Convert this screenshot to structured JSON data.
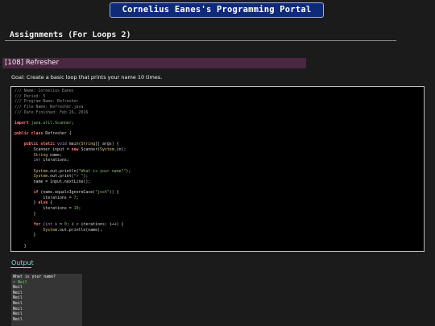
{
  "banner": {
    "title": "Cornelius Eanes's Programming Portal"
  },
  "page": {
    "title": "Assignments (For Loops 2)"
  },
  "assignment": {
    "header": "[108] Refresher",
    "goal": "Goal: Create a basic loop that prints your name 10 times."
  },
  "code": {
    "lines": [
      [
        [
          "c-comment",
          "/// Name: Cornelius Eanes"
        ]
      ],
      [
        [
          "c-comment",
          "/// Period: 5"
        ]
      ],
      [
        [
          "c-comment",
          "/// Program Name: Refresher"
        ]
      ],
      [
        [
          "c-comment",
          "/// File Name: Refresher.java"
        ]
      ],
      [
        [
          "c-comment",
          "/// Date Finished: Feb 26, 2016"
        ]
      ],
      [],
      [
        [
          "c-kw",
          "import"
        ],
        [
          "c-plain",
          " "
        ],
        [
          "c-str",
          "java.util.Scanner"
        ],
        [
          "c-plain",
          ";"
        ]
      ],
      [],
      [
        [
          "c-kw",
          "public class"
        ],
        [
          "c-plain",
          " Refresher {"
        ]
      ],
      [],
      [
        [
          "c-plain",
          "    "
        ],
        [
          "c-kw",
          "public static"
        ],
        [
          "c-plain",
          " "
        ],
        [
          "c-type",
          "void"
        ],
        [
          "c-plain",
          " main("
        ],
        [
          "c-cls",
          "String"
        ],
        [
          "c-plain",
          "[] args) {"
        ]
      ],
      [
        [
          "c-plain",
          "        Scanner input = "
        ],
        [
          "c-kw",
          "new"
        ],
        [
          "c-plain",
          " Scanner("
        ],
        [
          "c-cls",
          "System"
        ],
        [
          "c-plain",
          ".in);"
        ]
      ],
      [
        [
          "c-plain",
          "        "
        ],
        [
          "c-cls",
          "String"
        ],
        [
          "c-plain",
          " name;"
        ]
      ],
      [
        [
          "c-plain",
          "        "
        ],
        [
          "c-type",
          "int"
        ],
        [
          "c-plain",
          " iterations;"
        ]
      ],
      [],
      [
        [
          "c-plain",
          "        "
        ],
        [
          "c-cls",
          "System"
        ],
        [
          "c-plain",
          ".out.println("
        ],
        [
          "c-str",
          "\"What is your name?\""
        ],
        [
          "c-plain",
          ");"
        ]
      ],
      [
        [
          "c-plain",
          "        "
        ],
        [
          "c-cls",
          "System"
        ],
        [
          "c-plain",
          ".out.print("
        ],
        [
          "c-str",
          "\"> \""
        ],
        [
          "c-plain",
          ");"
        ]
      ],
      [
        [
          "c-plain",
          "        name = input.nextLine();"
        ]
      ],
      [],
      [
        [
          "c-plain",
          "        "
        ],
        [
          "c-kw",
          "if"
        ],
        [
          "c-plain",
          " (name.equalsIgnoreCase("
        ],
        [
          "c-str",
          "\"josh\""
        ],
        [
          "c-plain",
          ")) {"
        ]
      ],
      [
        [
          "c-plain",
          "            iterations = "
        ],
        [
          "c-str",
          "7"
        ],
        [
          "c-plain",
          ";"
        ]
      ],
      [
        [
          "c-plain",
          "        } "
        ],
        [
          "c-kw",
          "else"
        ],
        [
          "c-plain",
          " {"
        ]
      ],
      [
        [
          "c-plain",
          "            iterations = "
        ],
        [
          "c-str",
          "10"
        ],
        [
          "c-plain",
          ";"
        ]
      ],
      [
        [
          "c-plain",
          "        }"
        ]
      ],
      [],
      [
        [
          "c-plain",
          "        "
        ],
        [
          "c-kw",
          "for"
        ],
        [
          "c-plain",
          " ("
        ],
        [
          "c-type",
          "int"
        ],
        [
          "c-plain",
          " i = "
        ],
        [
          "c-str",
          "0"
        ],
        [
          "c-plain",
          "; i < iterations; i++) {"
        ]
      ],
      [
        [
          "c-plain",
          "            "
        ],
        [
          "c-cls",
          "System"
        ],
        [
          "c-plain",
          ".out.println(name);"
        ]
      ],
      [
        [
          "c-plain",
          "        }"
        ]
      ],
      [],
      [
        [
          "c-plain",
          "    }"
        ]
      ],
      [],
      [
        [
          "c-plain",
          "}"
        ]
      ]
    ]
  },
  "output": {
    "heading": "Output",
    "prompt": "What is your name?",
    "input_marker": ">",
    "input_value": "Neil",
    "lines": [
      "Neil",
      "Neil",
      "Neil",
      "Neil",
      "Neil",
      "Neil",
      "Neil"
    ]
  }
}
